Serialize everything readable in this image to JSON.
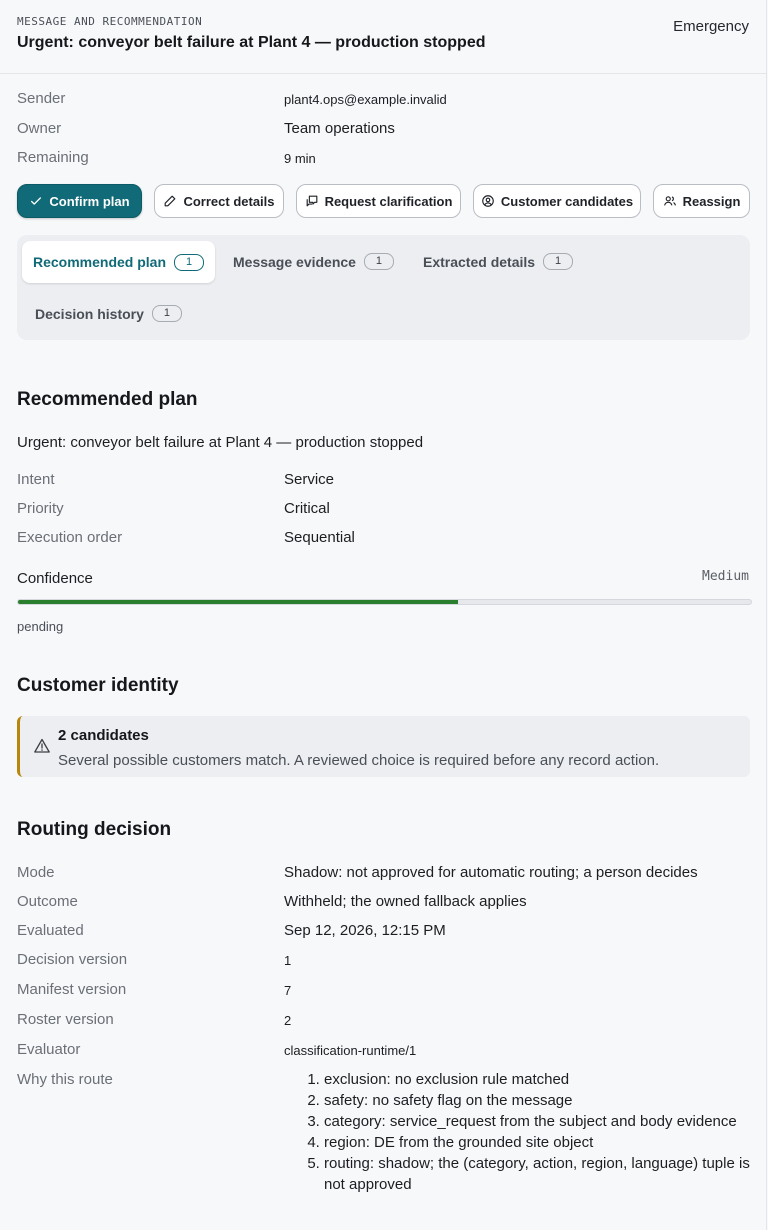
{
  "header": {
    "eyebrow": "MESSAGE AND RECOMMENDATION",
    "title": "Urgent: conveyor belt failure at Plant 4 — production stopped",
    "priority_badge": "Emergency"
  },
  "meta": [
    {
      "label": "Sender",
      "value": "plant4.ops@example.invalid"
    },
    {
      "label": "Owner",
      "value": "Team operations"
    },
    {
      "label": "Remaining",
      "value": "9 min"
    }
  ],
  "actions": {
    "confirm": "Confirm plan",
    "correct": "Correct details",
    "clarify": "Request clarification",
    "customers": "Customer candidates",
    "reassign": "Reassign"
  },
  "tabs": [
    {
      "label": "Recommended plan",
      "count": "1"
    },
    {
      "label": "Message evidence",
      "count": "1"
    },
    {
      "label": "Extracted details",
      "count": "1"
    },
    {
      "label": "Decision history",
      "count": "1"
    }
  ],
  "plan": {
    "heading": "Recommended plan",
    "subject": "Urgent: conveyor belt failure at Plant 4 — production stopped",
    "fields": [
      {
        "label": "Intent",
        "value": "Service"
      },
      {
        "label": "Priority",
        "value": "Critical"
      },
      {
        "label": "Execution order",
        "value": "Sequential"
      }
    ],
    "confidence_label": "Confidence",
    "confidence_level": "Medium",
    "confidence_fraction": 0.6,
    "status": "pending"
  },
  "customer": {
    "heading": "Customer identity",
    "alert_title": "2 candidates",
    "alert_body": "Several possible customers match. A reviewed choice is required before any record action."
  },
  "routing": {
    "heading": "Routing decision",
    "fields": [
      {
        "label": "Mode",
        "value": "Shadow: not approved for automatic routing; a person decides"
      },
      {
        "label": "Outcome",
        "value": "Withheld; the owned fallback applies"
      },
      {
        "label": "Evaluated",
        "value": "Sep 12, 2026, 12:15 PM"
      },
      {
        "label": "Decision version",
        "value": "1"
      },
      {
        "label": "Manifest version",
        "value": "7"
      },
      {
        "label": "Roster version",
        "value": "2"
      },
      {
        "label": "Evaluator",
        "value": "classification-runtime/1"
      }
    ],
    "why_label": "Why this route",
    "why": [
      "exclusion: no exclusion rule matched",
      "safety: no safety flag on the message",
      "category: service_request from the subject and body evidence",
      "region: DE from the grounded site object",
      "routing: shadow; the (category, action, region, language) tuple is not approved"
    ]
  },
  "colors": {
    "accent": "#106a77",
    "progress": "#2a7f2e",
    "warning": "#b8860b"
  },
  "icons": {
    "confirm": "check-icon",
    "correct": "pencil-icon",
    "clarify": "message-icon",
    "customers": "user-circle-icon",
    "reassign": "users-icon",
    "alert": "warning-triangle-icon"
  }
}
